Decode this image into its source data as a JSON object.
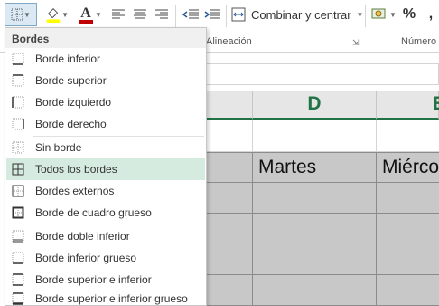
{
  "ribbon": {
    "merge_label": "Combinar y centrar",
    "number_symbols": {
      "percent": "%",
      "comma": ","
    },
    "groups": {
      "alignment": "Alineación",
      "number": "Número"
    },
    "colors": {
      "accent": "#217346",
      "font_color": "#c00000",
      "fill_color": "#ffff00"
    }
  },
  "grid": {
    "columns": [
      "D",
      "E"
    ],
    "cells": {
      "martes": "Martes",
      "miercoles": "Miérco"
    }
  },
  "border_menu": {
    "title": "Bordes",
    "items": [
      {
        "label": "Borde inferior",
        "icon": "bottom-border-icon"
      },
      {
        "label": "Borde superior",
        "icon": "top-border-icon"
      },
      {
        "label": "Borde izquierdo",
        "icon": "left-border-icon"
      },
      {
        "label": "Borde derecho",
        "icon": "right-border-icon"
      },
      {
        "label": "Sin borde",
        "icon": "no-border-icon"
      },
      {
        "label": "Todos los bordes",
        "icon": "all-borders-icon",
        "highlighted": true
      },
      {
        "label": "Bordes externos",
        "icon": "outside-borders-icon"
      },
      {
        "label": "Borde de cuadro grueso",
        "icon": "thick-box-border-icon"
      },
      {
        "label": "Borde doble inferior",
        "icon": "double-bottom-border-icon"
      },
      {
        "label": "Borde inferior grueso",
        "icon": "thick-bottom-border-icon"
      },
      {
        "label": "Borde superior e inferior",
        "icon": "top-bottom-border-icon"
      },
      {
        "label": "Borde superior e inferior grueso",
        "icon": "top-thick-bottom-border-icon"
      }
    ]
  }
}
